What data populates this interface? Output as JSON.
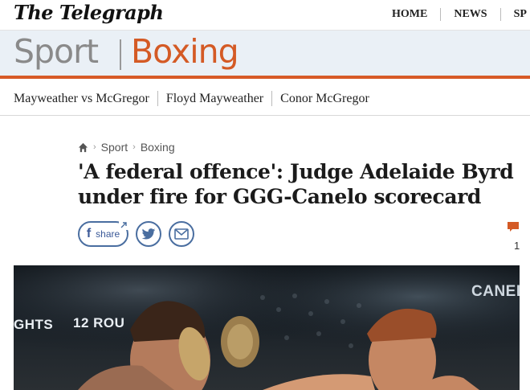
{
  "header": {
    "logo": "The Telegraph",
    "nav": [
      "HOME",
      "NEWS",
      "SP"
    ]
  },
  "section": {
    "parent": "Sport",
    "current": "Boxing"
  },
  "subnav": {
    "links": [
      "Mayweather vs McGregor",
      "Floyd Mayweather",
      "Conor McGregor"
    ]
  },
  "breadcrumb": {
    "items": [
      "Sport",
      "Boxing"
    ]
  },
  "article": {
    "headline": "'A federal offence': Judge Adelaide Byrd under fire for GGG-Canelo scorecard"
  },
  "share": {
    "facebook_label": "share"
  },
  "comments": {
    "count": "1"
  },
  "hero": {
    "texts": [
      "GHTS",
      "12 ROU",
      "CANELO"
    ]
  },
  "icons": {
    "home": "home-icon",
    "facebook": "facebook-icon",
    "twitter": "twitter-icon",
    "email": "email-icon",
    "comment": "comment-icon"
  },
  "colors": {
    "accent": "#d45a25",
    "banner_bg": "#eaf0f6",
    "social_blue": "#4a6ea0"
  }
}
